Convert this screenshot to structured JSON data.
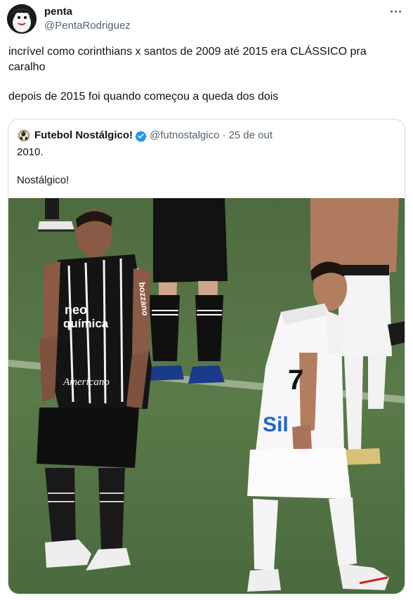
{
  "author": {
    "display_name": "penta",
    "handle": "@PentaRodriguez"
  },
  "tweet": {
    "line1": "incrível como corinthians x santos de 2009 até 2015 era CLÁSSICO pra caralho",
    "line2": "depois de 2015 foi quando começou a queda dos dois"
  },
  "quoted": {
    "display_name": "Futebol Nostálgico!",
    "handle": "@futnostalgico",
    "separator": "·",
    "date": "25 de out",
    "text_line1": "2010.",
    "text_line2": "Nostálgico!",
    "photo": {
      "left_shirt_text1": "neo",
      "left_shirt_text2": "química",
      "left_shirt_text3": "Americano",
      "left_sleeve_text": "bozzano",
      "right_shirt_number": "7",
      "right_shirt_text": "Sil"
    }
  },
  "colors": {
    "text_primary": "#0f1419",
    "text_secondary": "#536471",
    "border": "#cfd9de",
    "verified": "#1d9bf0"
  },
  "icons": {
    "more": "more-horizontal-icon",
    "verified": "verified-badge-icon"
  }
}
